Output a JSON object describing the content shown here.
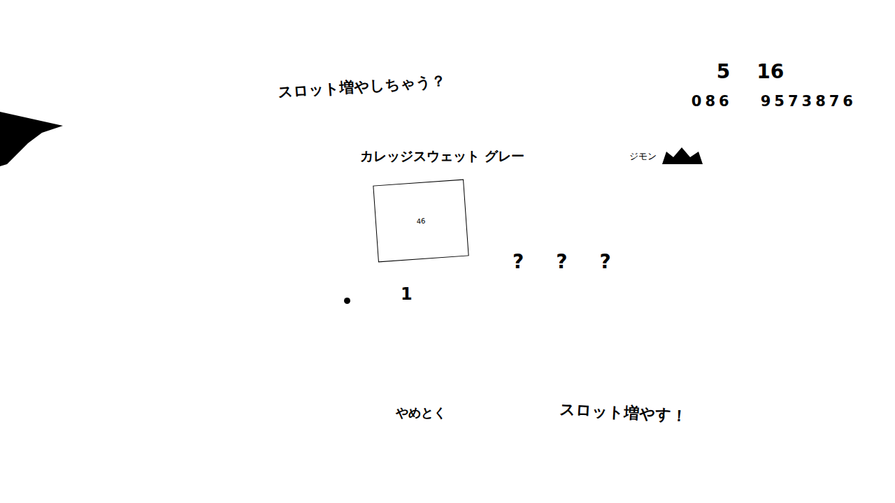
{
  "dialog": {
    "title": "スロット増やしちゃう？"
  },
  "hud": {
    "count_a": "5",
    "count_b": "16",
    "code_a": "086",
    "code_b": "9573876"
  },
  "gear": {
    "name": "カレッジスウェット グレー",
    "brand": "ジモン",
    "tag": "46"
  },
  "slots": [
    {
      "label": "?"
    },
    {
      "label": "?"
    },
    {
      "label": "?"
    }
  ],
  "cost": "1",
  "buttons": [
    {
      "label": "やめとく",
      "selected": false
    },
    {
      "label": "スロット増やす！",
      "selected": false
    }
  ]
}
